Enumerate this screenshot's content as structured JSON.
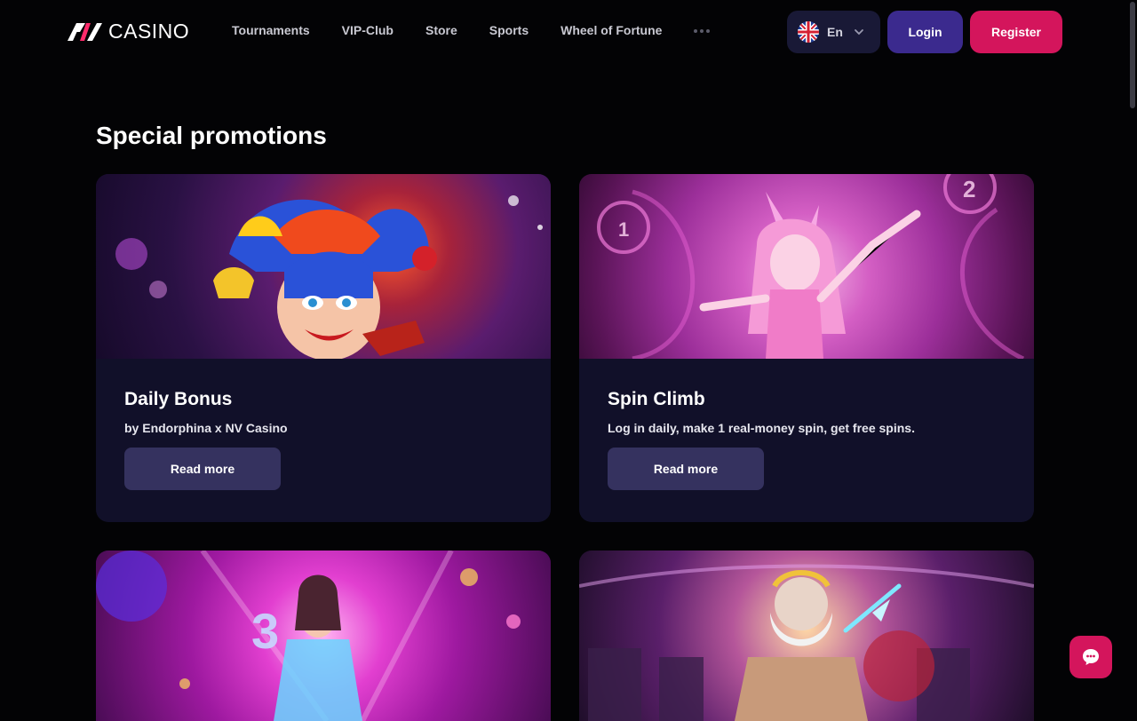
{
  "header": {
    "logo_text": "CASINO",
    "nav": [
      "Tournaments",
      "VIP-Club",
      "Store",
      "Sports",
      "Wheel of Fortune"
    ],
    "more_icon": "more-dots-icon",
    "language": {
      "label": "En",
      "flag_icon": "uk-flag-icon"
    },
    "login_label": "Login",
    "register_label": "Register"
  },
  "section": {
    "title": "Special promotions"
  },
  "promotions": [
    {
      "title": "Daily Bonus",
      "description": "by Endorphina x NV Casino",
      "button_label": "Read more"
    },
    {
      "title": "Spin Climb",
      "description": "Log in daily, make 1 real-money spin, get free spins.",
      "button_label": "Read more"
    }
  ],
  "chat": {
    "icon": "chat-bubble-icon"
  },
  "colors": {
    "accent": "#d4155c",
    "login": "#3b2a8e",
    "card_bg": "#111029",
    "button_bg": "#35325f"
  }
}
